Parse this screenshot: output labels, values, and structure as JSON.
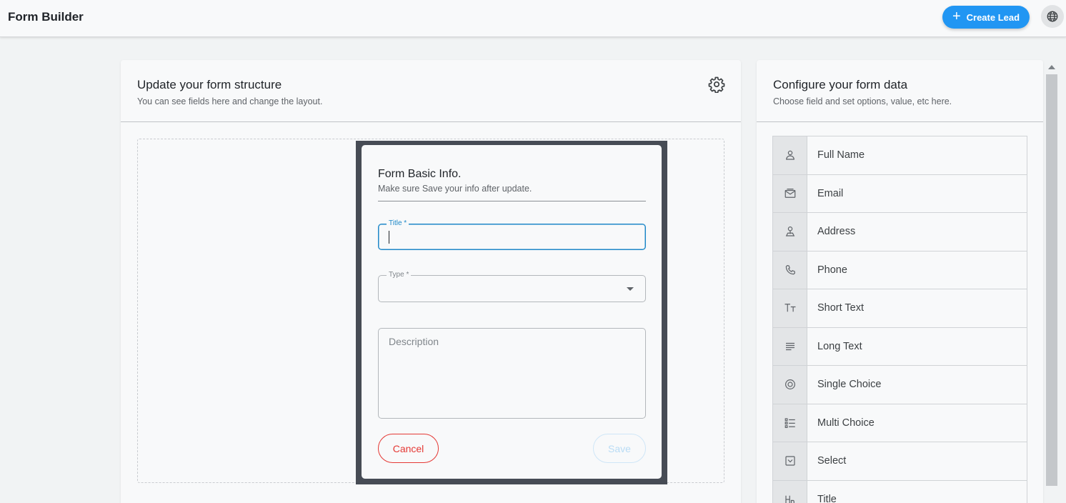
{
  "header": {
    "title": "Form Builder",
    "create_button_label": "Create Lead",
    "create_button_icon": "plus-icon",
    "language_icon": "globe-icon",
    "accent_color": "#2196f3"
  },
  "structure_panel": {
    "title": "Update your form structure",
    "subtitle": "You can see fields here and change the layout.",
    "settings_icon": "gear-icon"
  },
  "modal": {
    "title": "Form Basic Info.",
    "subtitle": "Make sure Save your info after update.",
    "title_field": {
      "label": "Title *",
      "value": ""
    },
    "type_field": {
      "label": "Type *",
      "value": ""
    },
    "description_field": {
      "placeholder": "Description",
      "value": ""
    },
    "cancel_label": "Cancel",
    "save_label": "Save",
    "cancel_color": "#e53935"
  },
  "data_panel": {
    "title": "Configure your form data",
    "subtitle": "Choose field and set options, value, etc here.",
    "fields": [
      {
        "label": "Full Name",
        "icon": "person-icon"
      },
      {
        "label": "Email",
        "icon": "email-icon"
      },
      {
        "label": "Address",
        "icon": "location-person-icon"
      },
      {
        "label": "Phone",
        "icon": "phone-icon"
      },
      {
        "label": "Short Text",
        "icon": "text-size-icon"
      },
      {
        "label": "Long Text",
        "icon": "paragraph-icon"
      },
      {
        "label": "Single Choice",
        "icon": "radio-icon"
      },
      {
        "label": "Multi Choice",
        "icon": "checklist-icon"
      },
      {
        "label": "Select",
        "icon": "select-box-icon"
      },
      {
        "label": "Title",
        "icon": "heading-icon"
      }
    ]
  }
}
